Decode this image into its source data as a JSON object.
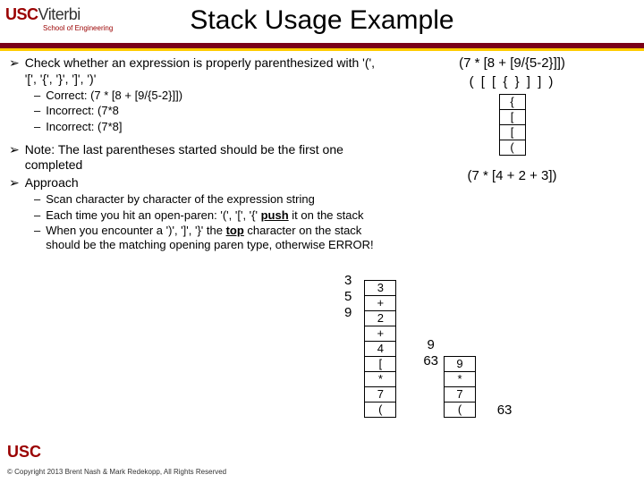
{
  "header": {
    "usc": "USC",
    "viterbi": "Viterbi",
    "school": "School of Engineering"
  },
  "title": "Stack Usage Example",
  "bullets": {
    "b1": "Check whether an expression is properly parenthesized with '(', '[', '{', '}', ']', ')'",
    "s1": "Correct:  (7 * [8 + [9/{5-2}]])",
    "s2": "Incorrect:  (7*8",
    "s3": "Incorrect:  (7*8]",
    "b2": "Note: The last parentheses started should be the first one completed",
    "b3": "Approach",
    "a1": "Scan character by character of the expression string",
    "a2a": "Each time you hit an open-paren: '(', '[', '{' ",
    "a2b": "push",
    "a2c": " it on the stack",
    "a3a": "When you encounter a ')', ']', '}' the ",
    "a3b": "top",
    "a3c": " character on the stack should be the matching opening paren type, otherwise ERROR!"
  },
  "right": {
    "expr1": "(7 * [8 + [9/{5-2}]])",
    "symbols": "(   [   [   {    } ]  ]   )",
    "stack1": [
      "{",
      "[",
      "[",
      "("
    ],
    "expr2": "(7 * [4 + 2 + 3])",
    "leftnums": [
      "3",
      "5",
      "9"
    ],
    "col1": [
      "3",
      "+",
      "2",
      "+",
      "4",
      "[",
      "*",
      "7",
      "("
    ],
    "col2top": [
      "9",
      "63"
    ],
    "col2": [
      "9",
      "*",
      "7",
      "("
    ],
    "result": "63"
  },
  "footer": {
    "logo": "USC",
    "copy": "© Copyright 2013 Brent Nash & Mark Redekopp, All Rights Reserved"
  }
}
